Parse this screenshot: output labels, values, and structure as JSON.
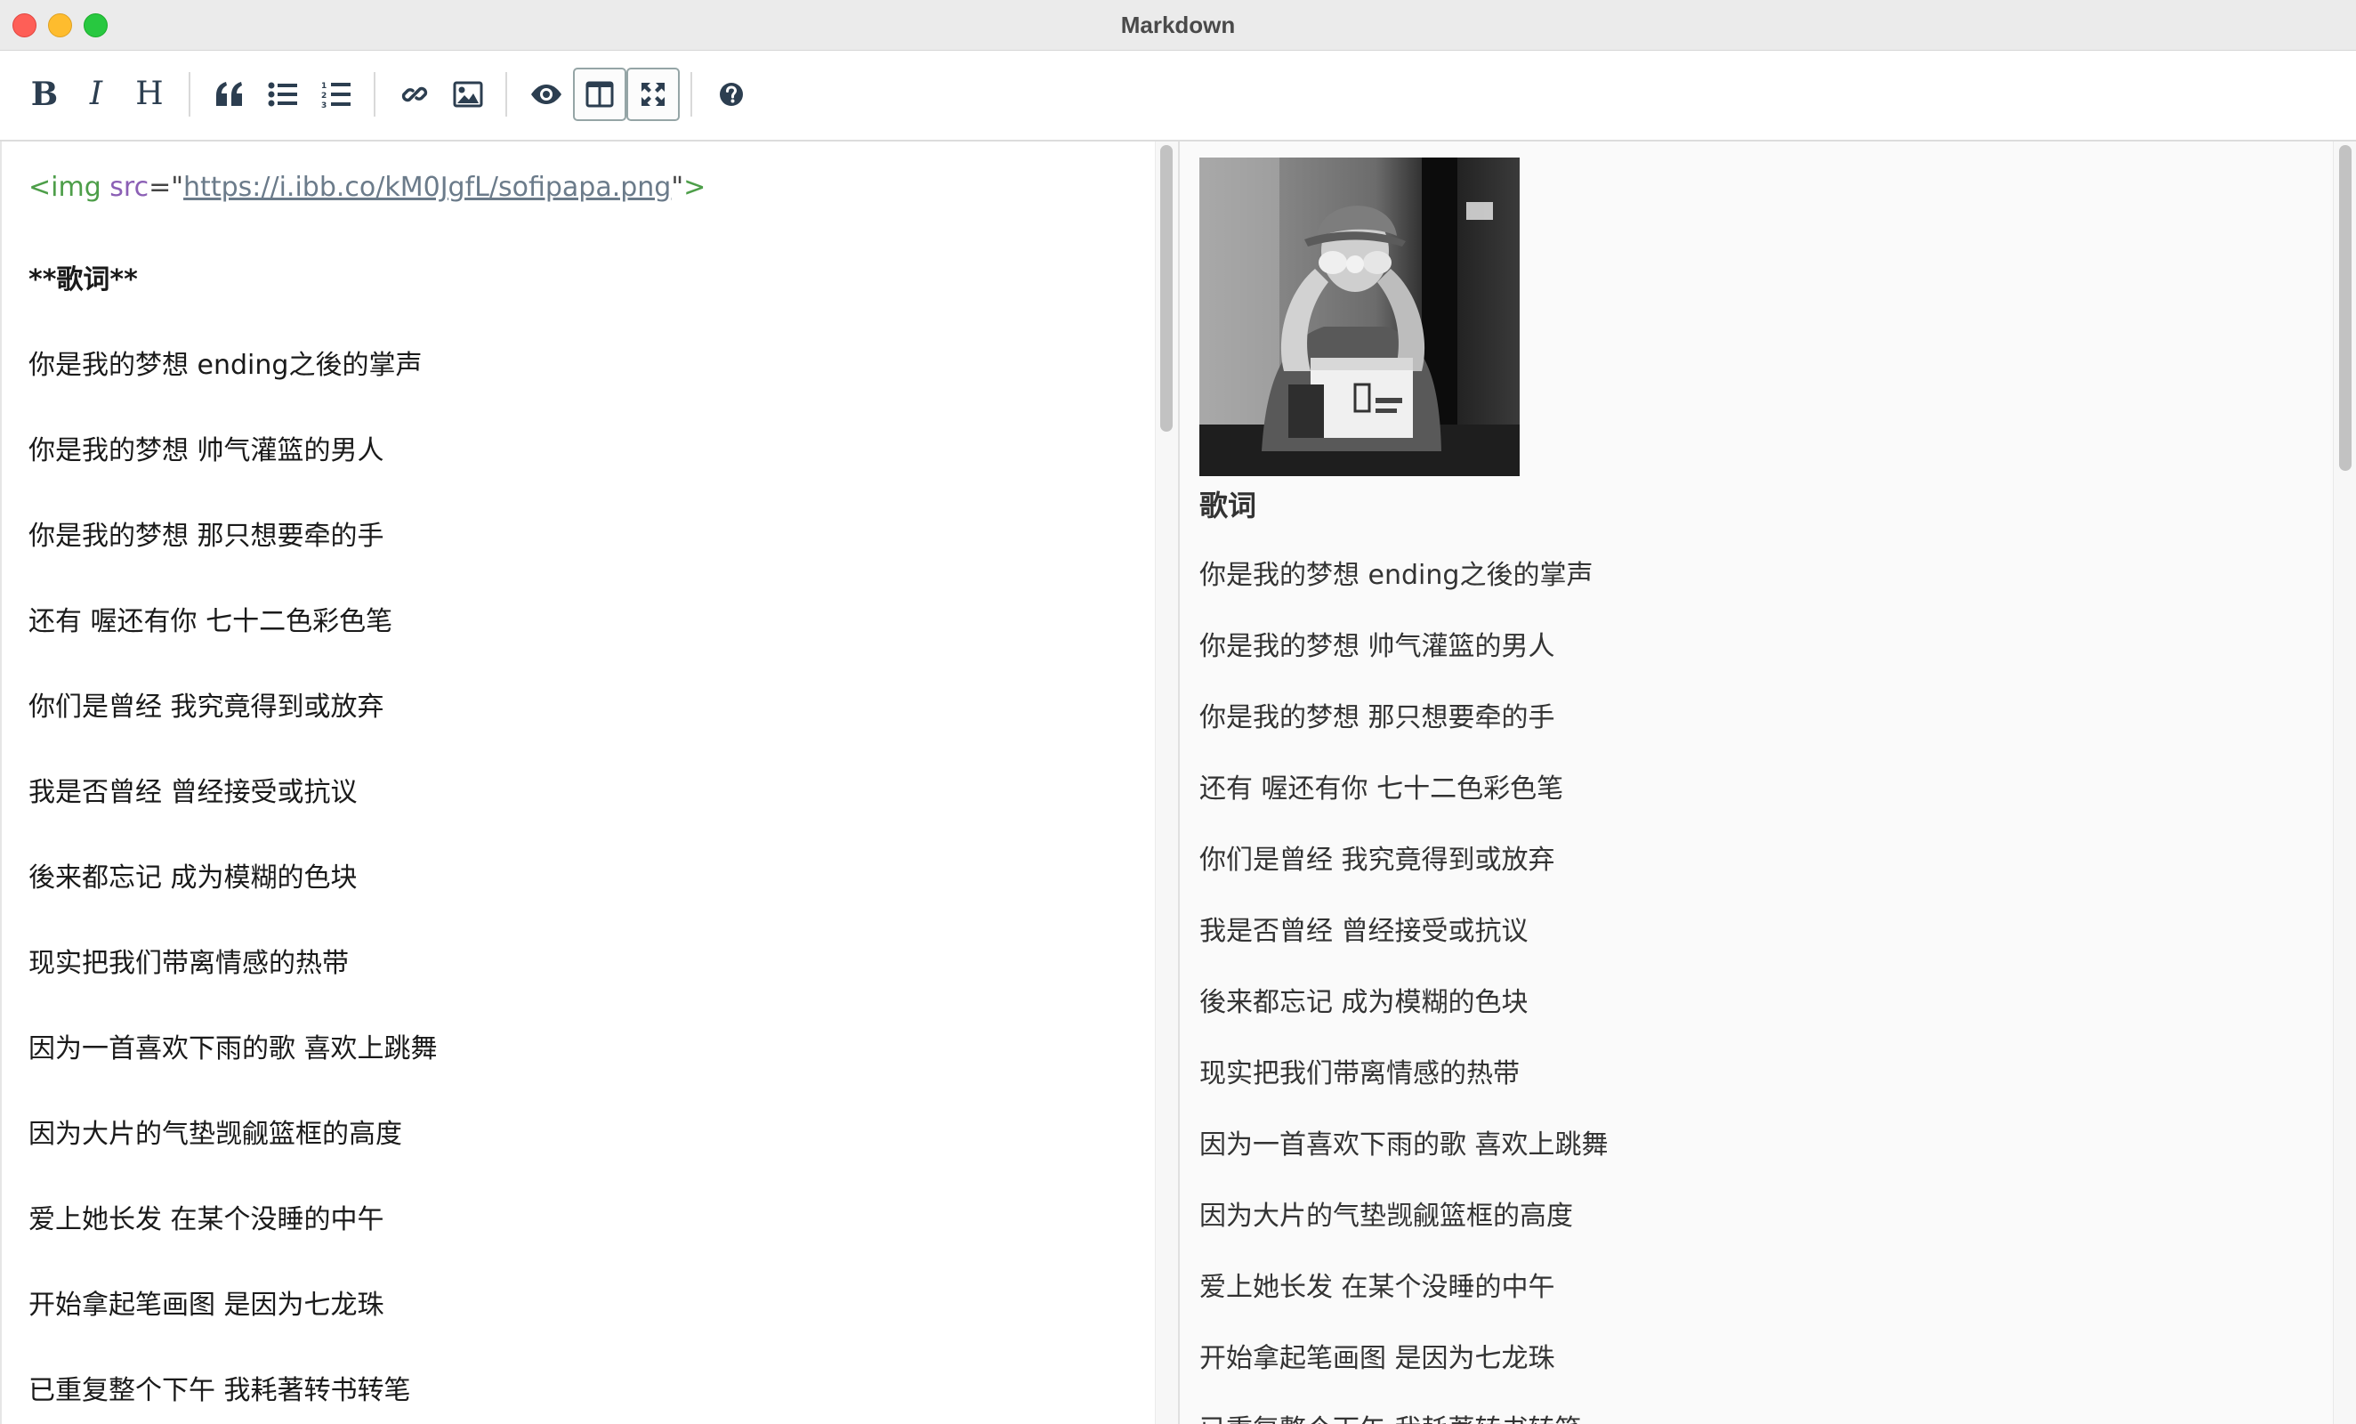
{
  "window": {
    "title": "Markdown"
  },
  "toolbar": {
    "bold_label": "B",
    "italic_label": "I",
    "heading_label": "H",
    "icons": [
      "bold-icon",
      "italic-icon",
      "heading-icon",
      "quote-icon",
      "unordered-list-icon",
      "ordered-list-icon",
      "link-icon",
      "image-icon",
      "preview-eye-icon",
      "side-by-side-icon",
      "fullscreen-icon",
      "help-icon"
    ],
    "active": [
      "side-by-side",
      "fullscreen"
    ]
  },
  "editor": {
    "img_tag": {
      "open": "<img",
      "attr": "src",
      "eq_quote": "=\"",
      "url": "https://i.ibb.co/kM0JgfL/sofipapa.png",
      "close_quote": "\"",
      "close": ">"
    },
    "bold_markdown": "**歌词**",
    "lines": [
      "你是我的梦想 ending之後的掌声",
      "你是我的梦想 帅气灌篮的男人",
      "你是我的梦想 那只想要牵的手",
      "还有 喔还有你 七十二色彩色笔",
      "你们是曾经 我究竟得到或放弃",
      "我是否曾经 曾经接受或抗议",
      "後来都忘记 成为模糊的色块",
      "现实把我们带离情感的热带",
      "因为一首喜欢下雨的歌 喜欢上跳舞",
      "因为大片的气垫觊觎篮框的高度",
      "爱上她长发 在某个没睡的中午",
      "开始拿起笔画图 是因为七龙珠",
      "已重复整个下午 我耗著转书转笔"
    ]
  },
  "preview": {
    "heading": "歌词",
    "lines": [
      "你是我的梦想 ending之後的掌声",
      "你是我的梦想 帅气灌篮的男人",
      "你是我的梦想 那只想要牵的手",
      "还有 喔还有你 七十二色彩色笔",
      "你们是曾经 我究竟得到或放弃",
      "我是否曾经 曾经接受或抗议",
      "後来都忘记 成为模糊的色块",
      "现实把我们带离情感的热带",
      "因为一首喜欢下雨的歌 喜欢上跳舞",
      "因为大片的气垫觊觎篮框的高度",
      "爱上她长发 在某个没睡的中午",
      "开始拿起笔画图 是因为七龙珠",
      "已重复整个下午 我耗著转书转笔"
    ]
  }
}
